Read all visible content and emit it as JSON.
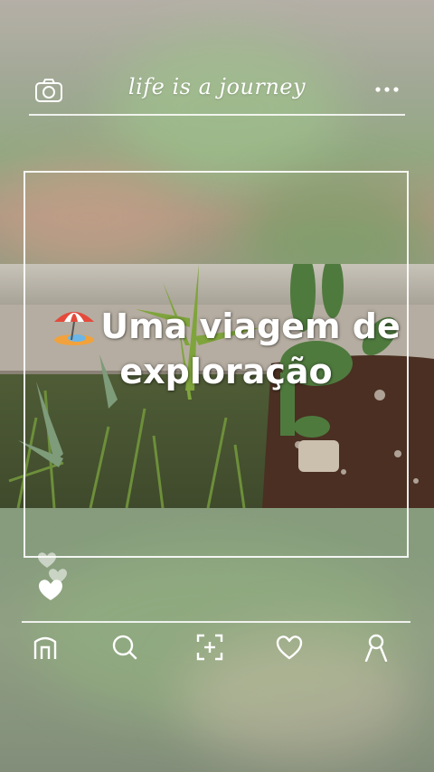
{
  "header": {
    "title": "life is a journey",
    "left_icon": "camera-icon",
    "right_icon": "more-icon"
  },
  "post": {
    "caption_line1": "Uma viagem de",
    "caption_line2": "exploração",
    "caption_icon": "beach-umbrella-icon",
    "likes_icons": [
      "heart-icon",
      "heart-icon",
      "heart-filled-icon"
    ]
  },
  "bottom_nav": [
    {
      "name": "home",
      "icon": "home-icon"
    },
    {
      "name": "search",
      "icon": "search-icon"
    },
    {
      "name": "scan",
      "icon": "scan-plus-icon"
    },
    {
      "name": "favorites",
      "icon": "heart-icon"
    },
    {
      "name": "profile",
      "icon": "profile-icon"
    }
  ],
  "colors": {
    "line": "#ffffff",
    "text": "#ffffff"
  }
}
